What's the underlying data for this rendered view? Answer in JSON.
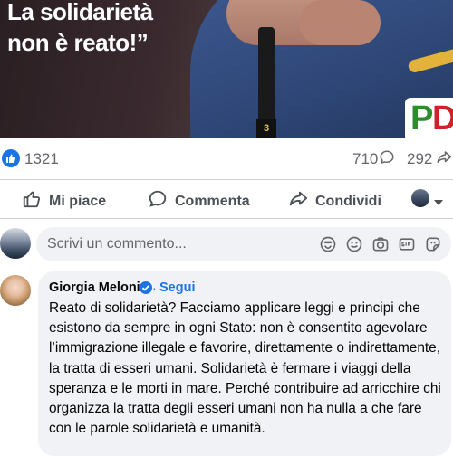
{
  "post": {
    "headline_line1": "La solidarietà",
    "headline_line2": "non è reato!”",
    "logo_text_p": "P",
    "logo_text_d": "D",
    "mic_tag": "3"
  },
  "stats": {
    "likes": "1321",
    "comments": "710",
    "shares": "292"
  },
  "actions": {
    "like": "Mi piace",
    "comment": "Commenta",
    "share": "Condividi"
  },
  "composer": {
    "placeholder": "Scrivi un commento..."
  },
  "comment": {
    "author": "Giorgia Meloni",
    "separator": "·",
    "follow": "Segui",
    "text": "Reato di solidarietà? Facciamo applicare leggi e principi che esistono da sempre in ogni Stato: non è consentito agevolare l’immigrazione illegale e favorire, direttamente o indirettamente, la tratta di esseri umani. Solidarietà è fermare i viaggi della speranza e le morti in mare. Perché contribuire ad arricchire chi organizza la tratta degli esseri umani non ha nulla a che fare con le parole solidarietà e umanità."
  },
  "colors": {
    "accent": "#1b74e4",
    "muted": "#65676b",
    "bubble": "#f0f2f5"
  },
  "icons": [
    "thumbs-up-icon",
    "comment-icon",
    "share-icon",
    "sticker-icon",
    "emoji-icon",
    "camera-icon",
    "gif-icon",
    "avatar-sticker-icon",
    "verified-icon",
    "chevron-down-icon"
  ]
}
